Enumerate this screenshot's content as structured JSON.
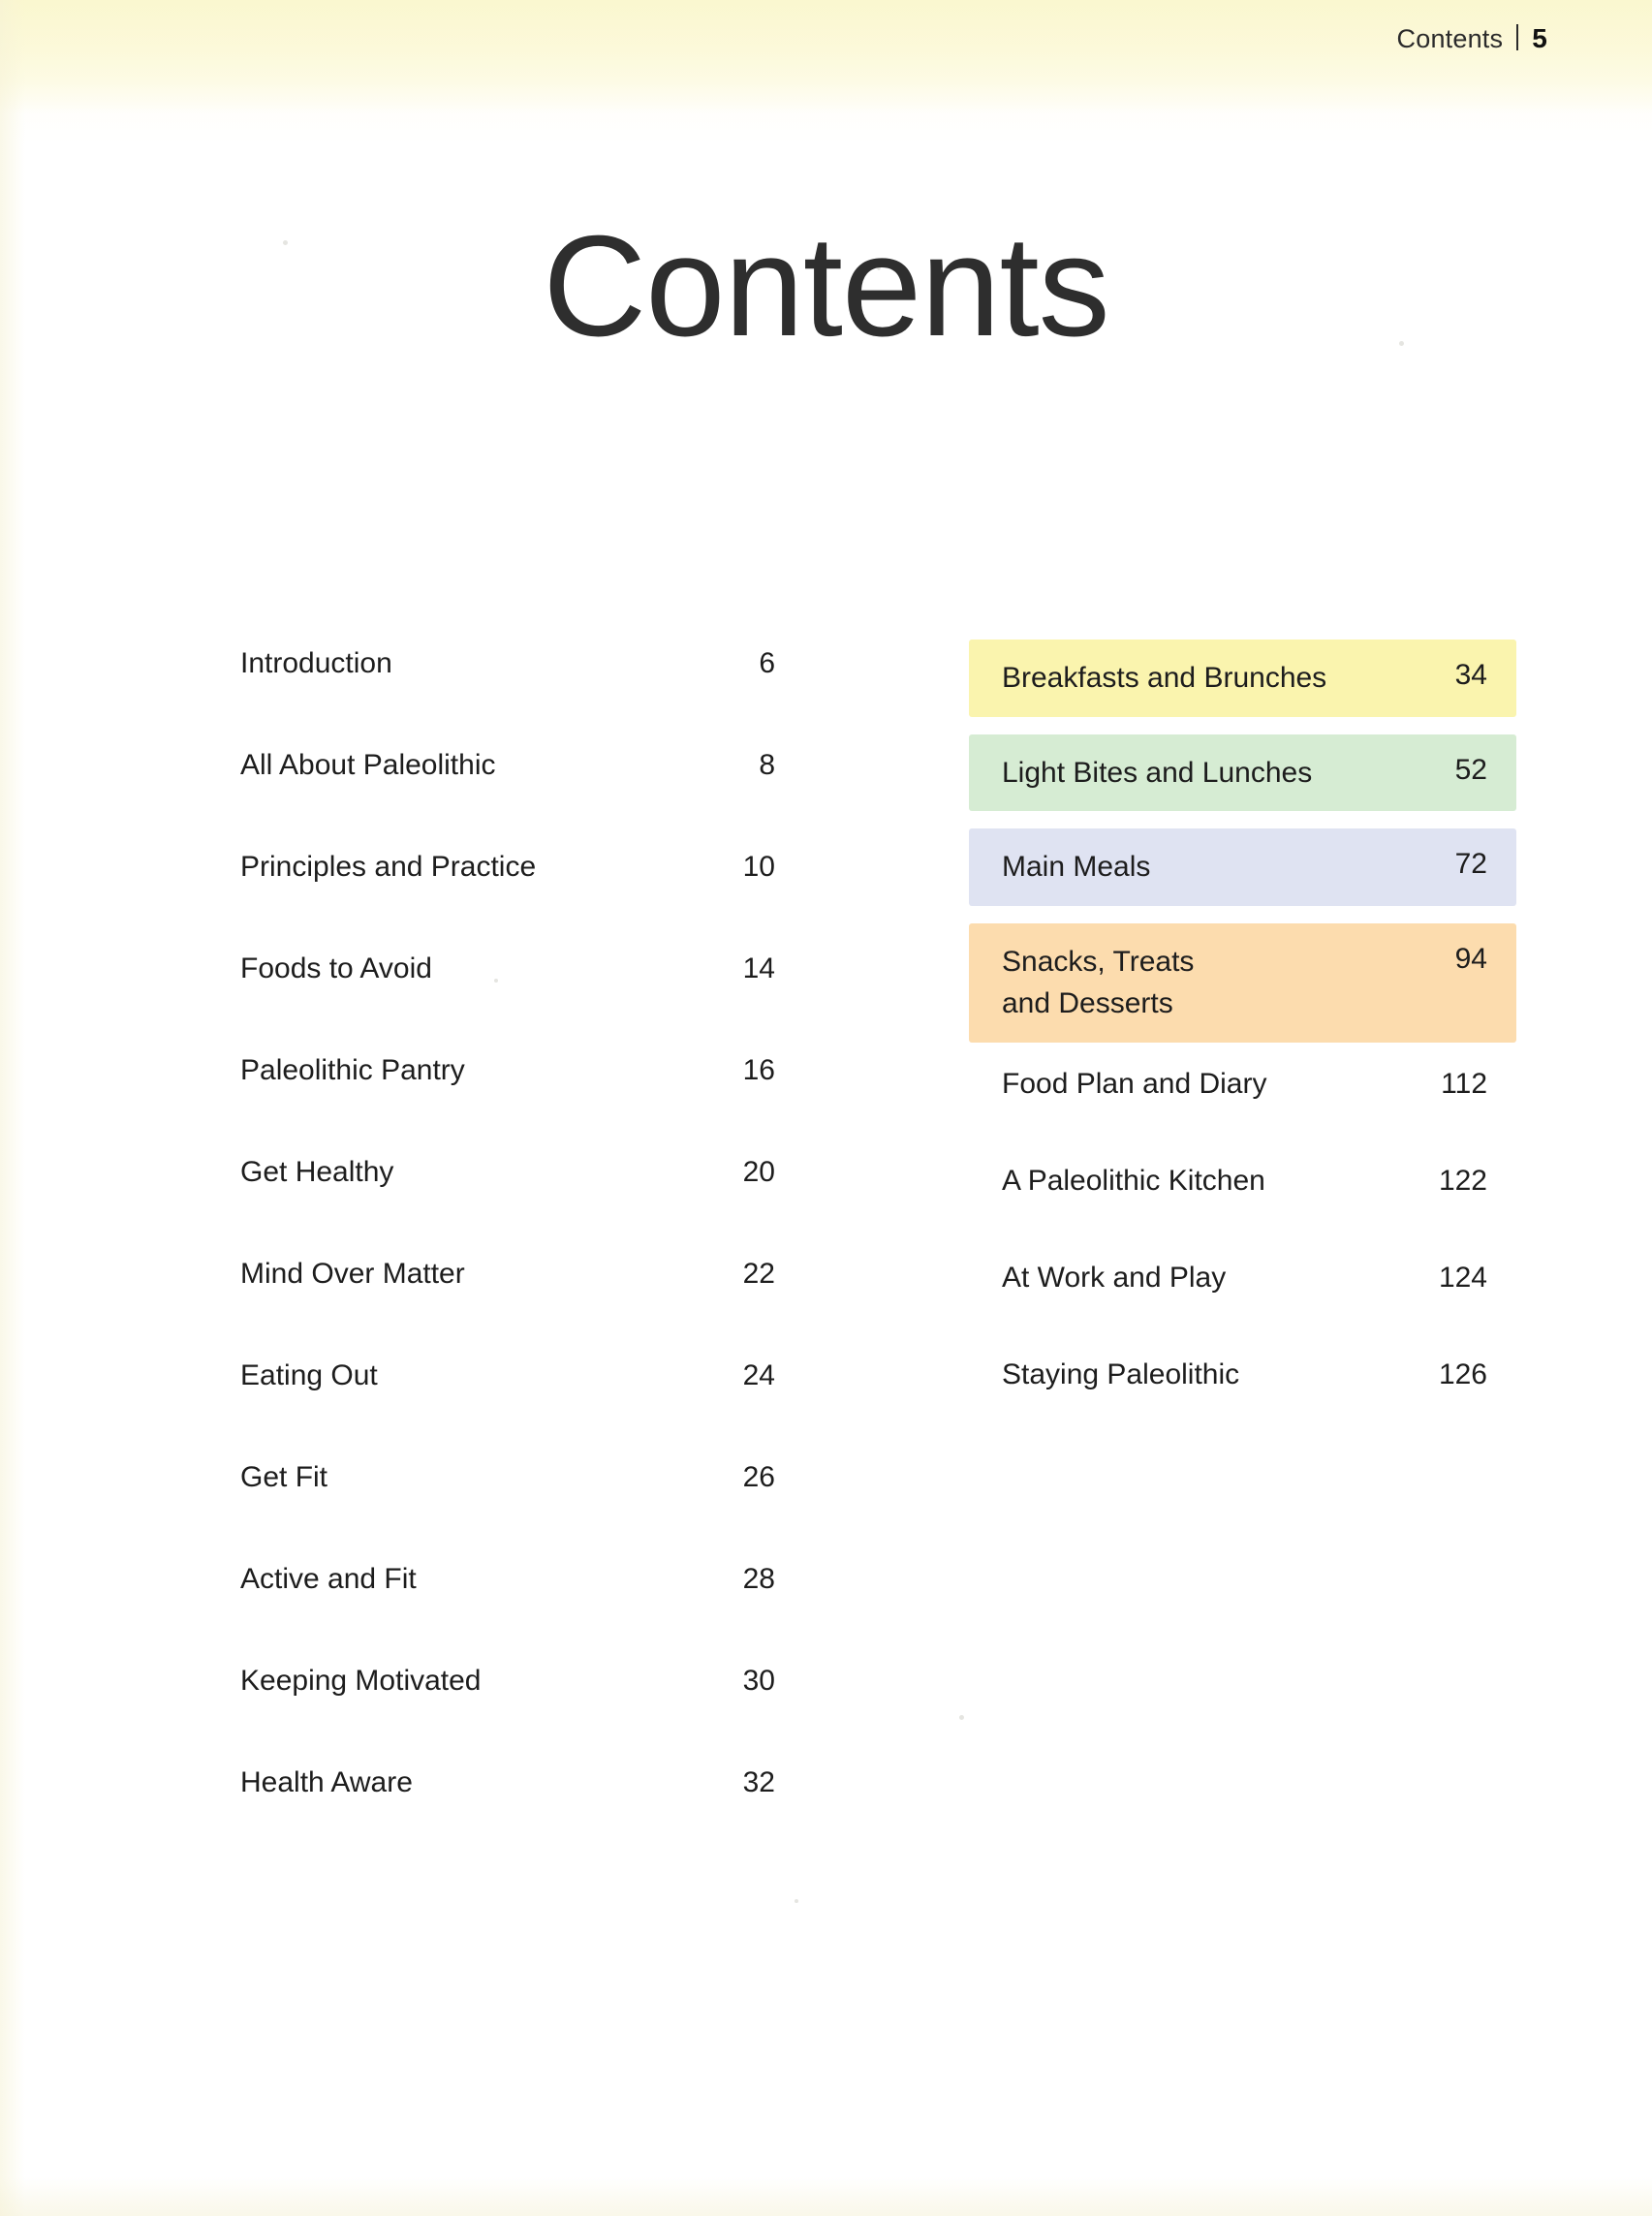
{
  "header": {
    "label": "Contents",
    "separator": "|",
    "folio": "5"
  },
  "title": "Contents",
  "toc": {
    "left_column": [
      {
        "title": "Introduction",
        "page": "6"
      },
      {
        "title": "All About Paleolithic",
        "page": "8"
      },
      {
        "title": "Principles and Practice",
        "page": "10"
      },
      {
        "title": "Foods to Avoid",
        "page": "14"
      },
      {
        "title": "Paleolithic Pantry",
        "page": "16"
      },
      {
        "title": "Get Healthy",
        "page": "20"
      },
      {
        "title": "Mind Over Matter",
        "page": "22"
      },
      {
        "title": "Eating Out",
        "page": "24"
      },
      {
        "title": "Get Fit",
        "page": "26"
      },
      {
        "title": "Active and Fit",
        "page": "28"
      },
      {
        "title": "Keeping Motivated",
        "page": "30"
      },
      {
        "title": "Health Aware",
        "page": "32"
      }
    ],
    "right_column": [
      {
        "title": "Breakfasts and Brunches",
        "page": "34",
        "highlight": "#faf4ae"
      },
      {
        "title": "Light Bites and Lunches",
        "page": "52",
        "highlight": "#d6ecd3"
      },
      {
        "title": "Main Meals",
        "page": "72",
        "highlight": "#dfe3f2"
      },
      {
        "title": "Snacks, Treats\nand Desserts",
        "page": "94",
        "highlight": "#fcdcae"
      },
      {
        "title": "Food Plan and Diary",
        "page": "112",
        "highlight": ""
      },
      {
        "title": "A Paleolithic Kitchen",
        "page": "122",
        "highlight": ""
      },
      {
        "title": "At Work and Play",
        "page": "124",
        "highlight": ""
      },
      {
        "title": "Staying Paleolithic",
        "page": "126",
        "highlight": ""
      }
    ]
  },
  "colors": {
    "paper": "#ffffff",
    "top_band": "#fbf8d8",
    "ink": "#1d1d1d"
  }
}
